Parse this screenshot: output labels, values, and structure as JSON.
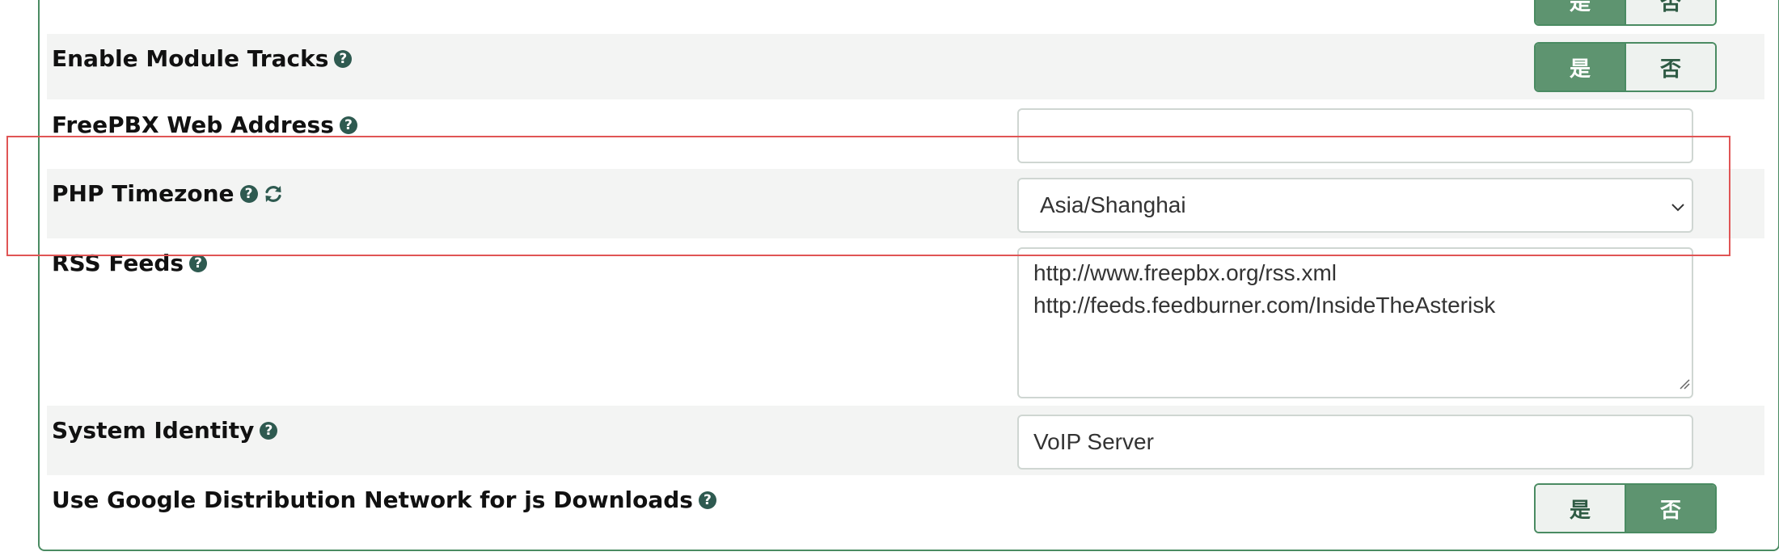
{
  "rows": [
    {
      "label": "Enable Module Tracks",
      "type": "toggle",
      "yes": "是",
      "no": "否",
      "selected": "yes"
    },
    {
      "label": "FreePBX Web Address",
      "type": "text",
      "value": ""
    },
    {
      "label": "PHP Timezone",
      "type": "select",
      "value": "Asia/Shanghai"
    },
    {
      "label": "RSS Feeds",
      "type": "textarea",
      "lines": [
        "http://www.freepbx.org/rss.xml",
        "http://feeds.feedburner.com/InsideTheAsterisk"
      ]
    },
    {
      "label": "System Identity",
      "type": "text",
      "value": "VoIP Server"
    },
    {
      "label": "Use Google Distribution Network for js Downloads",
      "type": "toggle",
      "yes": "是",
      "no": "否",
      "selected": "no"
    }
  ],
  "top_partial_toggle": {
    "yes": "是",
    "no": "否",
    "selected": "yes"
  },
  "help_glyph": "?",
  "colors": {
    "accent": "#4a8b62",
    "toggle_on": "#5e9470",
    "highlight": "#e05555",
    "help_icon": "#2e5a50"
  }
}
